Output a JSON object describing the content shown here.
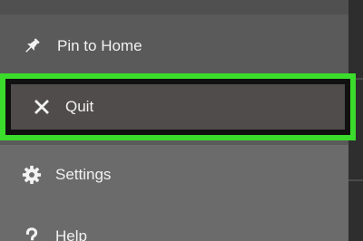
{
  "menu": {
    "items": [
      {
        "label": "Pin to Home",
        "icon": "pin-icon"
      },
      {
        "label": "Quit",
        "icon": "close-icon",
        "highlighted": true
      },
      {
        "label": "Settings",
        "icon": "gear-icon"
      },
      {
        "label": "Help",
        "icon": "question-icon"
      }
    ]
  },
  "colors": {
    "menu_background": "#5a5a5a",
    "lower_background": "#6b6b6b",
    "highlight_border": "#3bdc2b",
    "highlight_fill": "#4f4c4b",
    "text": "#f2f2f2"
  }
}
